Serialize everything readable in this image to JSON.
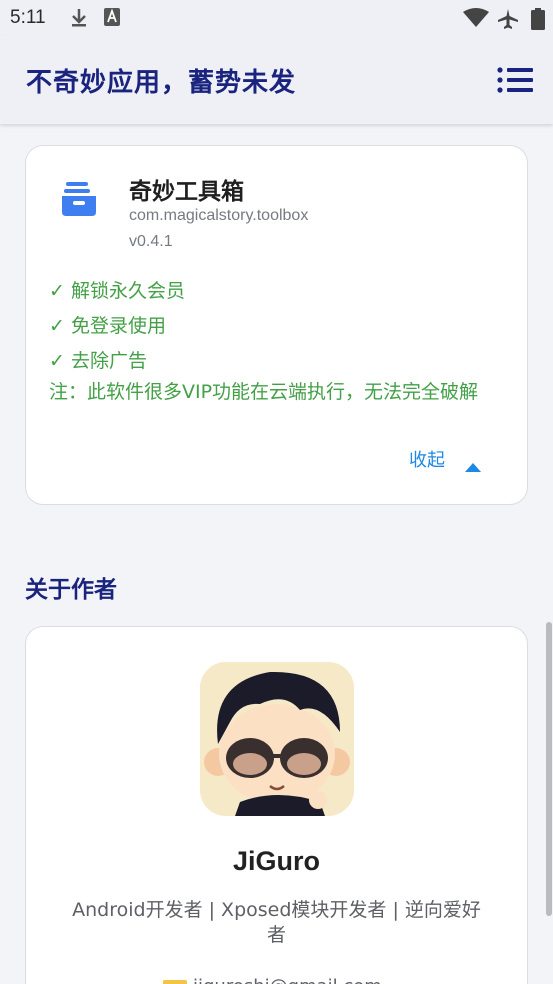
{
  "status_bar": {
    "time": "5:11",
    "icons": [
      "download-icon",
      "font-icon",
      "wifi-icon",
      "airplane-icon",
      "battery-icon"
    ]
  },
  "app_bar": {
    "title": "不奇妙应用，蓄势未发",
    "menu_icon": "list-menu-icon"
  },
  "app_card": {
    "icon": "toolbox-icon",
    "name": "奇妙工具箱",
    "package": "com.magicalstory.toolbox",
    "version": "v0.4.1",
    "features": [
      "✓ 解锁永久会员",
      "✓ 免登录使用",
      "✓ 去除广告"
    ],
    "note": "注：此软件很多VIP功能在云端执行，无法完全破解",
    "collapse_label": "收起"
  },
  "about": {
    "section_title": "关于作者",
    "author_name": "JiGuro",
    "author_desc": "Android开发者 | Xposed模块开发者 | 逆向爱好者",
    "email_partial": "jiguroshi@gmail.com"
  },
  "colors": {
    "title": "#1a237e",
    "feature": "#43a047",
    "accent": "#1e88e5",
    "background": "#f3f4f8"
  }
}
